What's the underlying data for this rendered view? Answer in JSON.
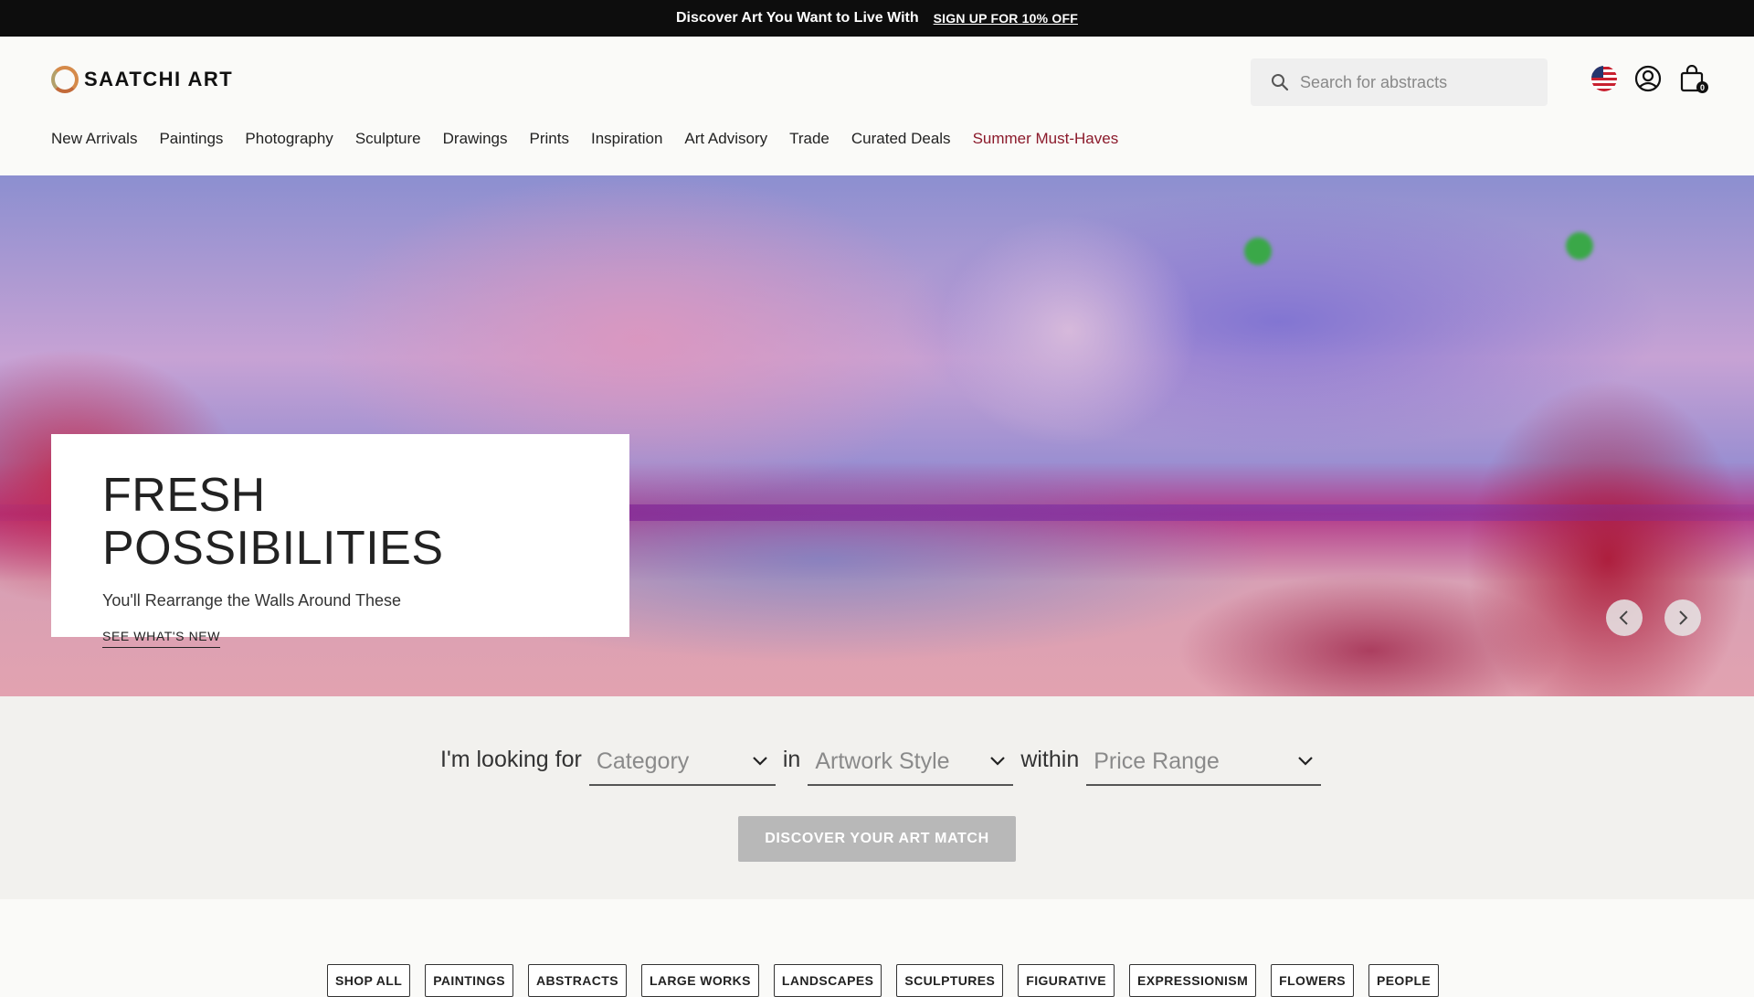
{
  "promo": {
    "text": "Discover Art You Want to Live With",
    "link": "SIGN UP FOR 10% OFF"
  },
  "header": {
    "logo": "SAATCHI ART",
    "search": {
      "placeholder": "Search for abstracts"
    },
    "cart_count": "0",
    "icons": [
      "us-flag-icon",
      "account-icon",
      "cart-icon",
      "search-icon"
    ]
  },
  "nav": {
    "items": [
      "New Arrivals",
      "Paintings",
      "Photography",
      "Sculpture",
      "Drawings",
      "Prints",
      "Inspiration",
      "Art Advisory",
      "Trade",
      "Curated Deals",
      "Summer Must-Haves"
    ],
    "highlight_color": "#8b1a2b"
  },
  "hero": {
    "title": "FRESH POSSIBILITIES",
    "subtitle": "You'll Rearrange the Walls Around These",
    "cta": "SEE WHAT'S NEW"
  },
  "finder": {
    "label_1": "I'm looking for",
    "select_1": "Category",
    "label_2": "in",
    "select_2": "Artwork Style",
    "label_3": "within",
    "select_3": "Price Range",
    "button": "DISCOVER YOUR ART MATCH"
  },
  "chips": [
    "SHOP ALL",
    "PAINTINGS",
    "ABSTRACTS",
    "LARGE WORKS",
    "LANDSCAPES",
    "SCULPTURES",
    "FIGURATIVE",
    "EXPRESSIONISM",
    "FLOWERS",
    "PEOPLE"
  ]
}
